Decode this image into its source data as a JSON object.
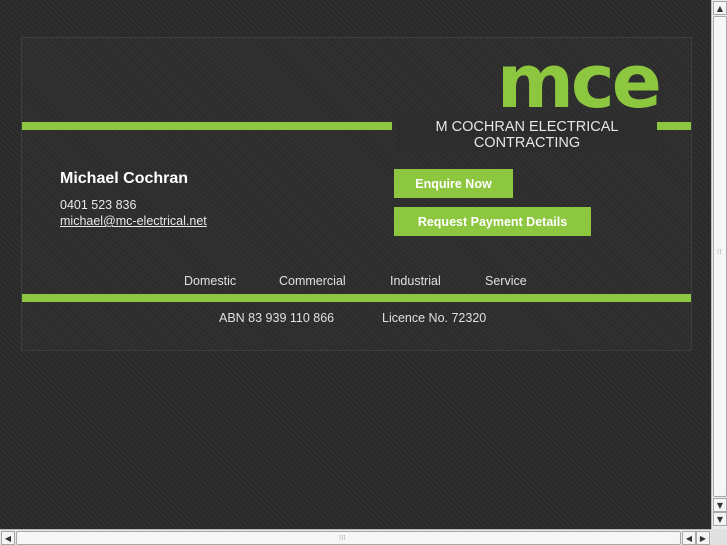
{
  "logo": {
    "text": "mce",
    "tagline": "M COCHRAN ELECTRICAL CONTRACTING"
  },
  "contact": {
    "name": "Michael Cochran",
    "phone": "0401 523 836",
    "email": "michael@mc-electrical.net"
  },
  "buttons": {
    "enquire": "Enquire Now",
    "payment": "Request Payment Details"
  },
  "nav": [
    "Domestic",
    "Commercial",
    "Industrial",
    "Service"
  ],
  "footer": {
    "abn": "ABN 83 939 110 866",
    "licence": "Licence No. 72320"
  },
  "colors": {
    "accent": "#8dc63f",
    "background": "#2b2a2a",
    "text": "#e6e6e6"
  },
  "icons": {
    "up": "arrow-up-icon",
    "down": "arrow-down-icon",
    "left": "arrow-left-icon",
    "right": "arrow-right-icon"
  }
}
